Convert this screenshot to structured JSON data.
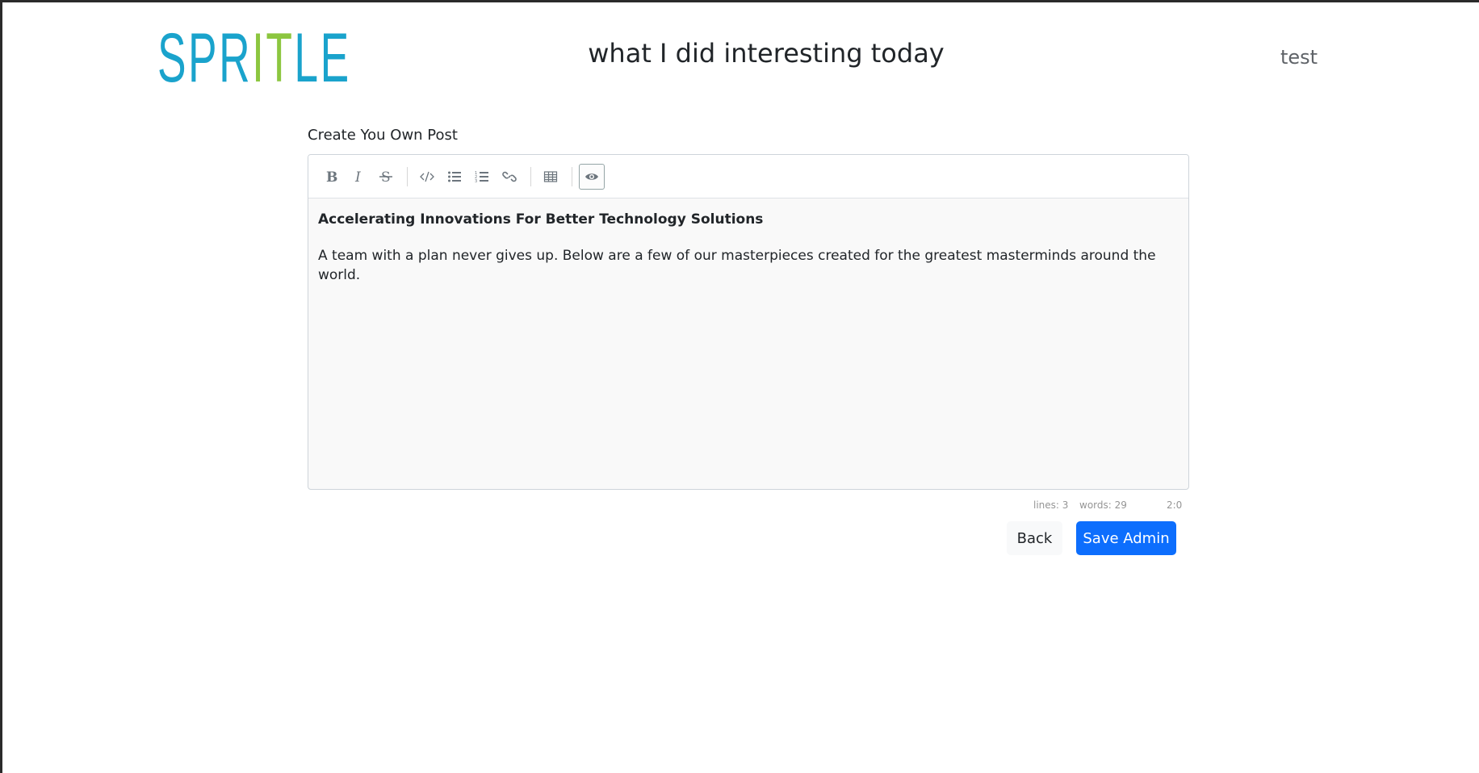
{
  "header": {
    "logo": {
      "part1": "SPR",
      "part2": "IT",
      "part3": "LE"
    },
    "title": "what I did interesting today",
    "user": "test"
  },
  "form": {
    "label": "Create You Own Post"
  },
  "editor": {
    "toolbar": [
      "bold-icon",
      "italic-icon",
      "strikethrough-icon",
      "code-icon",
      "unordered-list-icon",
      "ordered-list-icon",
      "link-icon",
      "table-icon",
      "preview-icon"
    ],
    "content": {
      "heading": "Accelerating Innovations For Better Technology Solutions",
      "paragraph": "A team with a plan never gives up. Below are a few of our masterpieces created for the greatest masterminds around the world."
    },
    "status": {
      "lines": "lines: 3",
      "words": "words: 29",
      "cursor": "2:0"
    }
  },
  "actions": {
    "back_label": "Back",
    "save_label": "Save Admin"
  },
  "colors": {
    "logo_blue": "#1aa3cc",
    "logo_green": "#8cc63f",
    "primary": "#0d6efd"
  }
}
